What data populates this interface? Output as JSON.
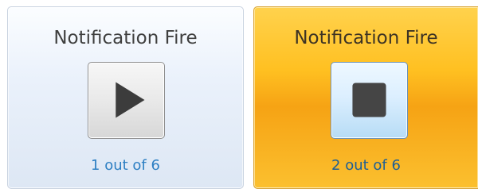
{
  "tiles": [
    {
      "title": "Notification Fire",
      "button_icon": "play-icon",
      "status": "1 out of 6",
      "state": "idle",
      "accent": "#2d7fc3"
    },
    {
      "title": "Notification Fire",
      "button_icon": "stop-icon",
      "status": "2 out of 6",
      "state": "active",
      "accent": "#1f5f95"
    }
  ],
  "colors": {
    "active_tile": "#f6a314",
    "idle_tile": "#dde7f4"
  }
}
